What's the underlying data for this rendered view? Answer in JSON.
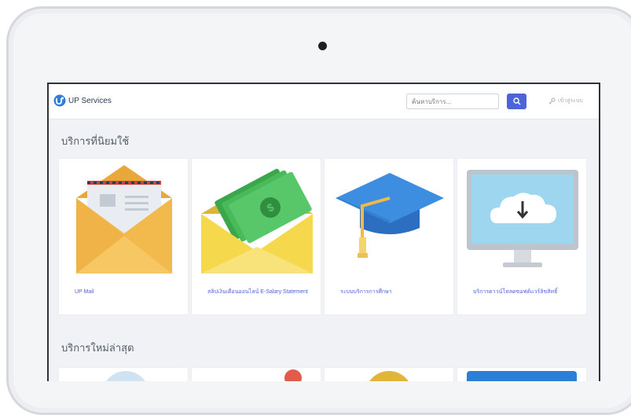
{
  "navbar": {
    "app_name": "UP Services",
    "search_placeholder": "ค้นหาบริการ...",
    "login_label": "เข้าสู่ระบบ"
  },
  "sections": {
    "popular_title": "บริการที่นิยมใช้",
    "latest_title": "บริการใหม่ล่าสุด"
  },
  "cards": [
    {
      "label": "UP Mail",
      "icon": "mail-envelope-icon"
    },
    {
      "label": "สลิปเงินเดือนออนไลน์ E-Salary Statement",
      "icon": "money-envelope-icon"
    },
    {
      "label": "ระบบบริการการศึกษา",
      "icon": "graduation-cap-icon"
    },
    {
      "label": "บริการดาวน์โหลดซอฟต์แวร์ลิขสิทธิ์",
      "icon": "cloud-download-icon"
    }
  ],
  "colors": {
    "accent": "#4d63d8",
    "card_bg": "#ffffff",
    "page_bg": "#f0f2f5"
  }
}
